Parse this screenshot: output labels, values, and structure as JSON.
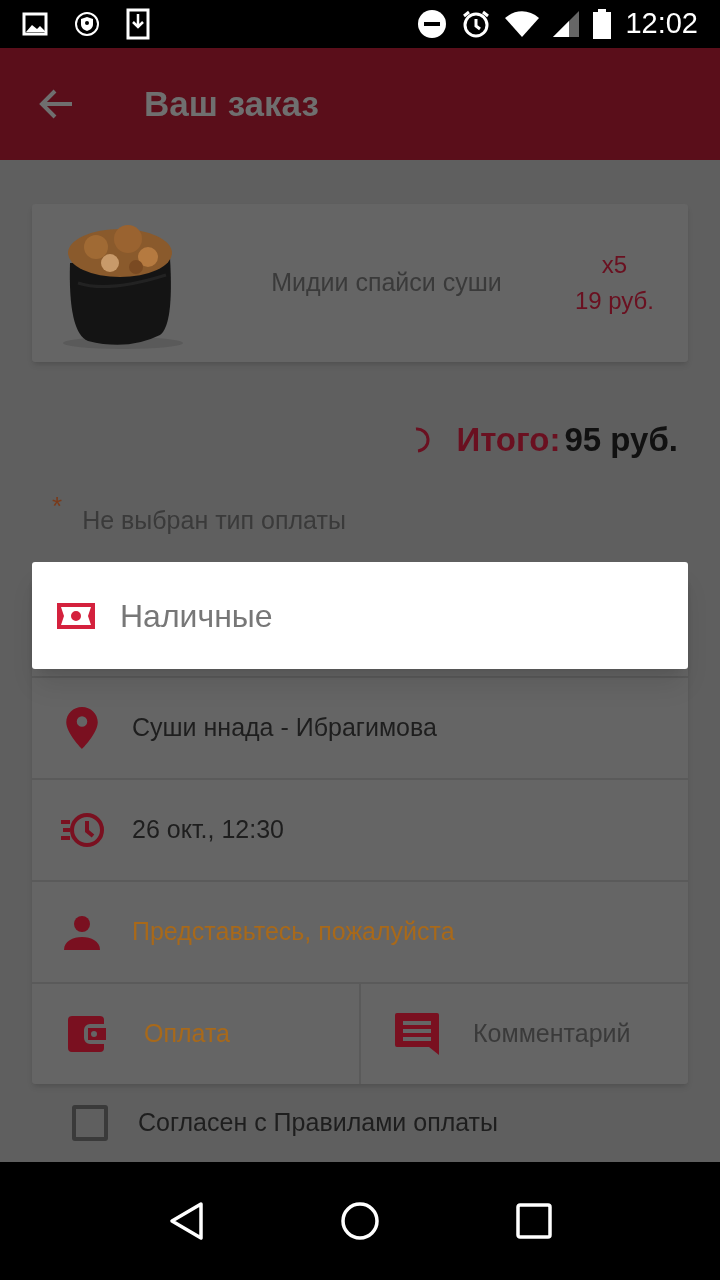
{
  "status_bar": {
    "time": "12:02"
  },
  "app_bar": {
    "title": "Ваш заказ"
  },
  "order_items": [
    {
      "name": "Мидии спайси суши",
      "quantity": "x5",
      "price": "19 руб."
    }
  ],
  "total": {
    "label": "Итого:",
    "value": "95 руб."
  },
  "payment_error": {
    "marker": "*",
    "text": "Не выбран тип оплаты"
  },
  "details": [
    {
      "kind": "location",
      "text": "Суши ннада - Ибрагимова",
      "highlighted": false
    },
    {
      "kind": "time",
      "text": "26 окт., 12:30",
      "highlighted": false
    },
    {
      "kind": "person",
      "text": "Представьтесь, пожалуйста",
      "highlighted": true
    }
  ],
  "actions": [
    {
      "kind": "wallet",
      "label": "Оплата",
      "highlighted": true
    },
    {
      "kind": "comment",
      "label": "Комментарий",
      "highlighted": false
    }
  ],
  "payment_popup": {
    "options": [
      {
        "kind": "cash",
        "label": "Наличные"
      }
    ]
  },
  "agreement": {
    "label": "Согласен с Правилами оплаты",
    "checked": false
  }
}
